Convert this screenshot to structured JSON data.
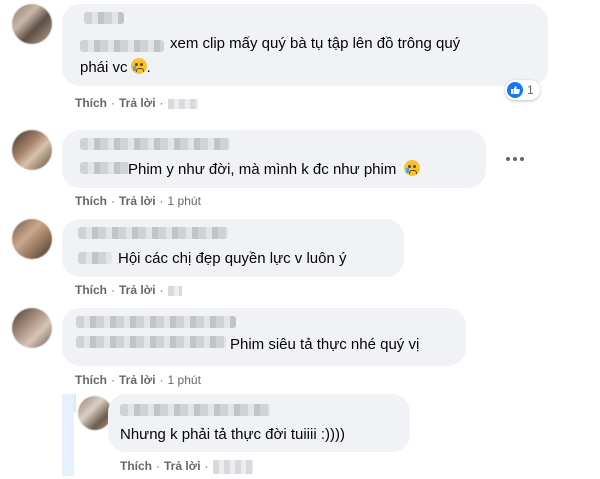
{
  "actions": {
    "like": "Thích",
    "reply": "Trả lời",
    "separator": "·"
  },
  "comments": [
    {
      "text_line1": "xem clip mấy quý bà tụ tập lên đồ trông quý",
      "text_line2": "phái vc",
      "reaction_count": "1",
      "time": ""
    },
    {
      "text": "Phim y như đời, mà mình k đc như phim",
      "time": "1 phút"
    },
    {
      "text": "Hội các chị đẹp quyền lực v luôn ý",
      "time": ""
    },
    {
      "text": "Phim siêu tả thực nhé quý vị",
      "time": "1 phút"
    },
    {
      "text": "Nhưng k phải tả thực đời tuiiii :))))",
      "time": ""
    }
  ],
  "icons": {
    "like": "thumbs-up-icon",
    "more": "more-options-icon",
    "emoji": "crying-face-icon"
  },
  "colors": {
    "bubble": "#f0f2f5",
    "action_text": "#65676b",
    "like_blue": "#1877f2"
  }
}
